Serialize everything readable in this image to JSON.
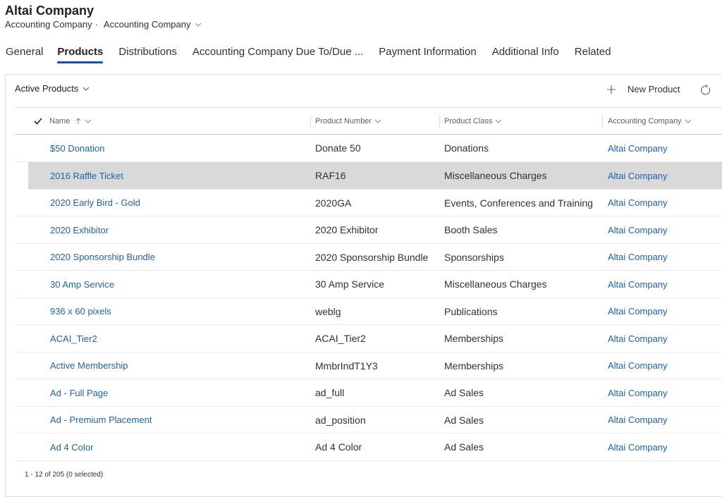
{
  "record": {
    "title": "Altai Company",
    "entity": "Accounting Company",
    "separator": "·",
    "form_name": "Accounting Company"
  },
  "tabs": [
    {
      "label": "General"
    },
    {
      "label": "Products"
    },
    {
      "label": "Distributions"
    },
    {
      "label": "Accounting Company Due To/Due ..."
    },
    {
      "label": "Payment Information"
    },
    {
      "label": "Additional Info"
    },
    {
      "label": "Related"
    }
  ],
  "subgrid": {
    "view_name": "Active Products",
    "new_label": "New Product",
    "columns": {
      "name": "Name",
      "product_number": "Product Number",
      "product_class": "Product Class",
      "accounting_company": "Accounting Company"
    },
    "rows": [
      {
        "name": "$50 Donation",
        "number": "Donate 50",
        "class": "Donations",
        "company": "Altai Company"
      },
      {
        "name": "2016 Raffle Ticket",
        "number": "RAF16",
        "class": "Miscellaneous Charges",
        "company": "Altai Company"
      },
      {
        "name": "2020 Early Bird - Gold",
        "number": "2020GA",
        "class": "Events, Conferences and Training",
        "company": "Altai Company"
      },
      {
        "name": "2020 Exhibitor",
        "number": "2020 Exhibitor",
        "class": "Booth Sales",
        "company": "Altai Company"
      },
      {
        "name": "2020 Sponsorship Bundle",
        "number": "2020 Sponsorship Bundle",
        "class": "Sponsorships",
        "company": "Altai Company"
      },
      {
        "name": "30 Amp Service",
        "number": "30 Amp Service",
        "class": "Miscellaneous Charges",
        "company": "Altai Company"
      },
      {
        "name": "936 x 60 pixels",
        "number": "weblg",
        "class": "Publications",
        "company": "Altai Company"
      },
      {
        "name": "ACAI_Tier2",
        "number": "ACAI_Tier2",
        "class": "Memberships",
        "company": "Altai Company"
      },
      {
        "name": "Active Membership",
        "number": "MmbrIndT1Y3",
        "class": "Memberships",
        "company": "Altai Company"
      },
      {
        "name": "Ad - Full Page",
        "number": "ad_full",
        "class": "Ad Sales",
        "company": "Altai Company"
      },
      {
        "name": "Ad - Premium Placement",
        "number": "ad_position",
        "class": "Ad Sales",
        "company": "Altai Company"
      },
      {
        "name": "Ad 4 Color",
        "number": "Ad 4 Color",
        "class": "Ad Sales",
        "company": "Altai Company"
      }
    ],
    "footer": "1 - 12 of 205 (0 selected)"
  },
  "colors": {
    "accent": "#1f4e9c",
    "link": "#1f62a8",
    "selected_row": "#d9d9d9"
  }
}
